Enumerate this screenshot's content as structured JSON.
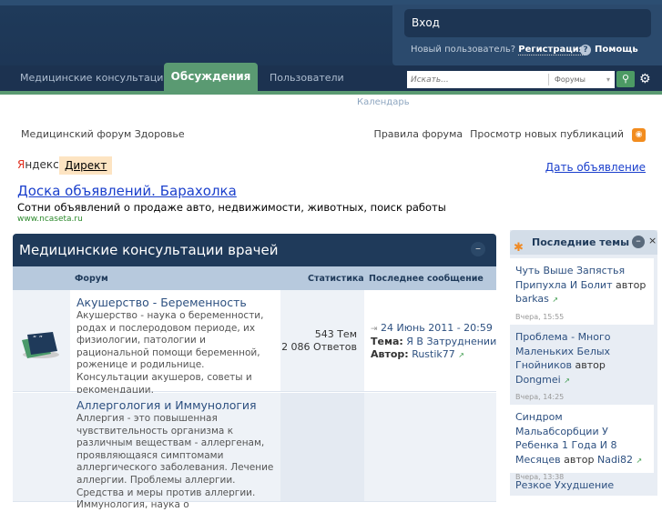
{
  "nav": {
    "tabs": [
      {
        "label": "Медицинские консультации"
      },
      {
        "label": "Обсуждения"
      },
      {
        "label": "Пользователи"
      }
    ],
    "sub": "Календарь"
  },
  "user": {
    "login": "Вход",
    "new_user": "Новый пользователь?",
    "register": "Регистрация",
    "help": "Помощь"
  },
  "search": {
    "placeholder": "Искать...",
    "scope": "Форумы"
  },
  "breadcrumb": "Медицинский форум Здоровье",
  "links": {
    "rules": "Правила форума",
    "new_posts": "Просмотр новых публикаций"
  },
  "ad": {
    "ya": "Я",
    "ndex": "ндекс",
    "direct": "Директ",
    "give": "Дать объявление",
    "title": "Доска объявлений. Барахолка",
    "desc": "Сотни объявлений о продаже авто, недвижимости, животных, поиск работы",
    "url": "www.ncaseta.ru"
  },
  "category": {
    "title": "Медицинские консультации врачей",
    "cols": {
      "forum": "Форум",
      "stats": "Статистика",
      "last": "Последнее сообщение"
    },
    "forums": [
      {
        "title": "Акушерство - Беременность",
        "desc": "Акушерство - наука о беременности, родах и послеродовом периоде, их физиологии, патологии и рациональной помощи беременной, роженице и родильнице. Консультации акушеров, советы и рекомендации.",
        "topics": "543 Тем",
        "replies": "2 086 Ответов",
        "last_date": "24 Июнь 2011 - 20:59",
        "topic_label": "Тема:",
        "topic": "Я В Затруднении",
        "author_label": "Автор:",
        "author": "Rustik77"
      },
      {
        "title": "Аллергология и Иммунология",
        "desc": "Аллергия - это повышенная чувствительность организма к различным веществам - аллергенам, проявляющаяся симптомами аллергического заболевания. Лечение аллергии. Проблемы аллергии. Средства и меры против аллергии. Иммунология, наука о"
      }
    ]
  },
  "sidebar": {
    "title": "Последние темы",
    "by": "автор",
    "items": [
      {
        "title": "Чуть Выше Запястья Припухла И Болит",
        "author": "barkas",
        "time": "Вчера, 15:55"
      },
      {
        "title": "Проблема - Много Маленьких Белых Гнойников",
        "author": "Dongmei",
        "time": "Вчера, 14:25"
      },
      {
        "title": "Синдром Мальабсорбции У Ребенка 1 Года И 8 Месяцев",
        "author": "Nadi82",
        "time": "Вчера, 13:38"
      },
      {
        "title": "Резкое Ухудшение"
      }
    ]
  }
}
